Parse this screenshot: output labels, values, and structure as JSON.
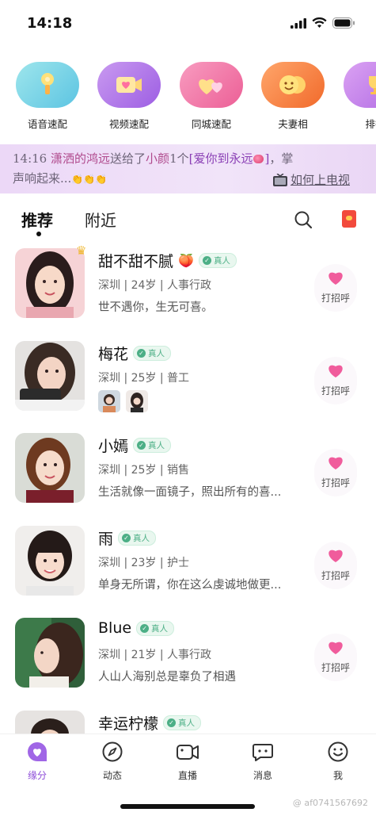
{
  "status": {
    "time": "14:18"
  },
  "quick_actions": [
    {
      "label": "语音速配",
      "icon": "microphone-icon",
      "color": "#6dcde0"
    },
    {
      "label": "视频速配",
      "icon": "video-heart-icon",
      "color": "#b57be8"
    },
    {
      "label": "同城速配",
      "icon": "hearts-icon",
      "color": "#f06fa5"
    },
    {
      "label": "夫妻相",
      "icon": "couple-faces-icon",
      "color": "#f47f2e"
    },
    {
      "label": "排行",
      "icon": "trophy-icon",
      "color": "#c07be9"
    }
  ],
  "announcement": {
    "time": "14:16",
    "sender": "潇洒的鸿远",
    "verb": "送给了",
    "receiver": "小颜",
    "count": "1个",
    "gift": "[爱你到永远",
    "gift_end": "]",
    "tail1": "，掌",
    "tail2": "声响起来...",
    "claps": "👏👏👏",
    "tv_link": "如何上电视"
  },
  "tabs": {
    "active": "推荐",
    "other": "附近"
  },
  "verified_label": "真人",
  "greet_label": "打招呼",
  "users": [
    {
      "name": "甜不甜不腻",
      "meta": "深圳 | 24岁 | 人事行政",
      "bio": "世不遇你，生无可喜。",
      "emoji": "🍑"
    },
    {
      "name": "梅花",
      "meta": "深圳 | 25岁 | 普工",
      "bio": ""
    },
    {
      "name": "小嫣",
      "meta": "深圳 | 25岁 | 销售",
      "bio": "生活就像一面镜子，照出所有的喜..."
    },
    {
      "name": "雨",
      "meta": "深圳 | 23岁 | 护士",
      "bio": "单身无所谓，你在这么虔诚地做更..."
    },
    {
      "name": "Blue",
      "meta": "深圳 | 21岁 | 人事行政",
      "bio": "人山人海别总是辜负了相遇"
    },
    {
      "name": "幸运柠檬",
      "meta": "",
      "bio": ""
    }
  ],
  "bottom_nav": [
    {
      "label": "缘分",
      "icon": "heart-chat-icon",
      "active": true
    },
    {
      "label": "动态",
      "icon": "compass-icon",
      "active": false
    },
    {
      "label": "直播",
      "icon": "video-camera-icon",
      "active": false
    },
    {
      "label": "消息",
      "icon": "message-icon",
      "active": false
    },
    {
      "label": "我",
      "icon": "smile-icon",
      "active": false
    }
  ],
  "watermark": "@ af0741567692",
  "colors": {
    "accent": "#8d4bd8",
    "heart": "#f05c9c",
    "verified": "#4caf86"
  }
}
